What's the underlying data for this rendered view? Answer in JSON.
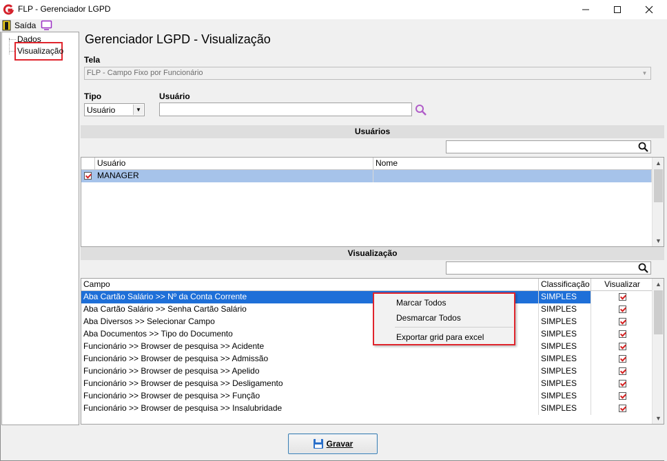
{
  "window": {
    "title": "FLP - Gerenciador LGPD"
  },
  "menubar": {
    "items": [
      {
        "label": "Saída",
        "icon": "exit-door-icon"
      },
      {
        "icon": "monitor-icon"
      }
    ]
  },
  "tree": {
    "items": [
      {
        "label": "Dados"
      },
      {
        "label": "Visualização",
        "selected": true
      }
    ]
  },
  "page": {
    "title": "Gerenciador LGPD - Visualização"
  },
  "tela": {
    "label": "Tela",
    "value": "FLP - Campo Fixo por Funcionário"
  },
  "tipo": {
    "label": "Tipo",
    "value": "Usuário"
  },
  "usuario": {
    "label": "Usuário",
    "value": ""
  },
  "usuarios_section": {
    "title": "Usuários",
    "search_value": "",
    "columns": [
      "Usuário",
      "Nome"
    ],
    "rows": [
      {
        "checked": true,
        "usuario": "MANAGER",
        "nome": ""
      }
    ]
  },
  "visualizacao_section": {
    "title": "Visualização",
    "search_value": "",
    "columns": [
      "Campo",
      "Classificação",
      "Visualizar"
    ],
    "rows": [
      {
        "campo": "Aba Cartão Salário >> Nº da Conta Corrente",
        "classificacao": "SIMPLES",
        "visualizar": true
      },
      {
        "campo": "Aba Cartão Salário >> Senha Cartão Salário",
        "classificacao": "SIMPLES",
        "visualizar": true
      },
      {
        "campo": "Aba Diversos >> Selecionar Campo",
        "classificacao": "SIMPLES",
        "visualizar": true
      },
      {
        "campo": "Aba Documentos >> Tipo do Documento",
        "classificacao": "SIMPLES",
        "visualizar": true
      },
      {
        "campo": "Funcionário >> Browser de pesquisa >> Acidente",
        "classificacao": "SIMPLES",
        "visualizar": true
      },
      {
        "campo": "Funcionário >> Browser de pesquisa >> Admissão",
        "classificacao": "SIMPLES",
        "visualizar": true
      },
      {
        "campo": "Funcionário >> Browser de pesquisa >> Apelido",
        "classificacao": "SIMPLES",
        "visualizar": true
      },
      {
        "campo": "Funcionário >> Browser de pesquisa >> Desligamento",
        "classificacao": "SIMPLES",
        "visualizar": true
      },
      {
        "campo": "Funcionário >> Browser de pesquisa >> Função",
        "classificacao": "SIMPLES",
        "visualizar": true
      },
      {
        "campo": "Funcionário >> Browser de pesquisa >> Insalubridade",
        "classificacao": "SIMPLES",
        "visualizar": true
      }
    ]
  },
  "context_menu": {
    "items": [
      "Marcar Todos",
      "Desmarcar Todos",
      "Exportar grid para excel"
    ]
  },
  "footer": {
    "save_label": "Gravar"
  },
  "colors": {
    "selection": "#1e6fd8",
    "highlight_border": "#e0242c",
    "search_icon": "#b05cc8"
  }
}
